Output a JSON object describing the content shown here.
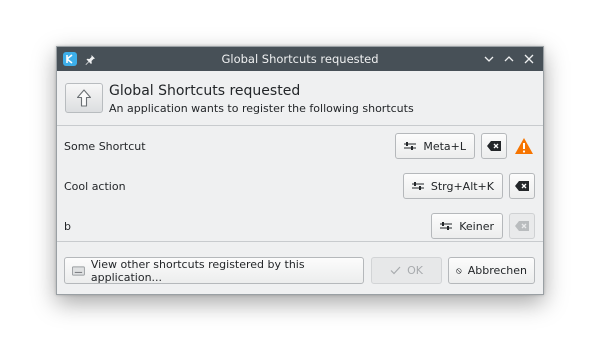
{
  "window": {
    "title": "Global Shortcuts requested"
  },
  "header": {
    "title": "Global Shortcuts requested",
    "subtitle": "An application wants to register the following shortcuts",
    "icon": "go-up-arrow-icon"
  },
  "shortcuts": [
    {
      "label": "Some Shortcut",
      "key": "Meta+L",
      "clear_enabled": true,
      "warning": true
    },
    {
      "label": "Cool action",
      "key": "Strg+Alt+K",
      "clear_enabled": true,
      "warning": false
    },
    {
      "label": "b",
      "key": "Keiner",
      "clear_enabled": false,
      "warning": false
    }
  ],
  "footer": {
    "view_other_label": "View other shortcuts registered by this application...",
    "ok_label": "OK",
    "cancel_label": "Abbrechen"
  },
  "colors": {
    "titlebar": "#475057",
    "accent": "#3daee9",
    "warning": "#f67400"
  }
}
